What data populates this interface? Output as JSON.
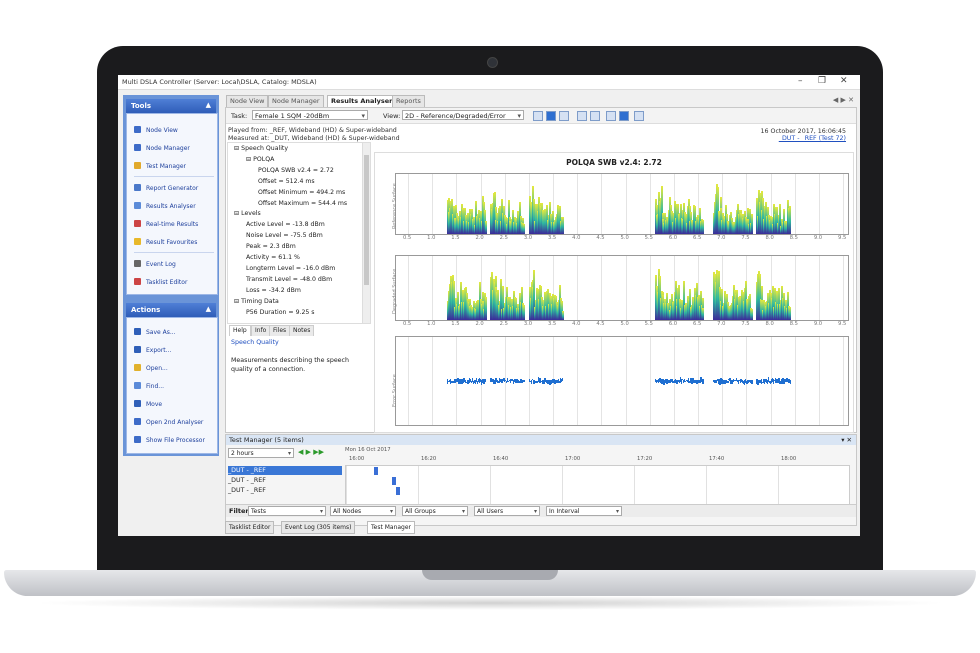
{
  "window": {
    "title": "Multi DSLA Controller (Server: Local\\DSLA, Catalog: MDSLA)",
    "controls": [
      "–",
      "❐",
      "✕"
    ]
  },
  "nav": {
    "tools_header": "Tools",
    "tools": [
      "Node View",
      "Node Manager",
      "Test Manager",
      "Report Generator",
      "Results Analyser",
      "Real-time Results",
      "Result Favourites",
      "Event Log",
      "Tasklist Editor"
    ],
    "actions_header": "Actions",
    "actions": [
      "Save As...",
      "Export...",
      "Open...",
      "Find...",
      "Move",
      "Open 2nd Analyser",
      "Show File Processor"
    ],
    "collapse": "▲"
  },
  "tabs": [
    "Node View",
    "Node Manager",
    "Results Analyser 1",
    "Reports"
  ],
  "tab_close": "✕",
  "nav_arrows": "◀ ▶ ✕",
  "toolbar": {
    "task_label": "Task:",
    "task_value": "Female 1 SQM -20dBm",
    "view_label": "View:",
    "view_value": "2D - Reference/Degraded/Error"
  },
  "info": {
    "played": "Played from: _REF, Wideband (HD) & Super-wideband",
    "measured": "Measured at: _DUT, Wideband (HD) & Super-wideband",
    "date": "16 October 2017, 16:06:45",
    "link": "_DUT - _REF (Test 72)"
  },
  "tree": [
    {
      "indent": 0,
      "text": "⊟ Speech Quality"
    },
    {
      "indent": 1,
      "text": "⊟ POLQA"
    },
    {
      "indent": 2,
      "text": "POLQA SWB v2.4 = 2.72"
    },
    {
      "indent": 2,
      "text": "Offset = 512.4 ms"
    },
    {
      "indent": 2,
      "text": "Offset Minimum = 494.2 ms"
    },
    {
      "indent": 2,
      "text": "Offset Maximum = 544.4 ms"
    },
    {
      "indent": 0,
      "text": "⊟ Levels"
    },
    {
      "indent": 1,
      "text": "Active Level = -13.8 dBm"
    },
    {
      "indent": 1,
      "text": "Noise Level = -75.5 dBm"
    },
    {
      "indent": 1,
      "text": "Peak = 2.3 dBm"
    },
    {
      "indent": 1,
      "text": "Activity = 61.1 %"
    },
    {
      "indent": 1,
      "text": "Longterm Level = -16.0 dBm"
    },
    {
      "indent": 1,
      "text": "Transmit Level = -48.0 dBm"
    },
    {
      "indent": 1,
      "text": "Loss = -34.2 dBm"
    },
    {
      "indent": 0,
      "text": "⊟ Timing Data"
    },
    {
      "indent": 1,
      "text": "P56 Duration = 9.25 s"
    }
  ],
  "help_tabs": [
    "Help",
    "Info",
    "Files",
    "Notes"
  ],
  "help": {
    "title": "Speech Quality",
    "body": "Measurements describing the speech quality of a connection."
  },
  "chart_data": {
    "type": "bar",
    "title": "POLQA SWB v2.4: 2.72",
    "panels": [
      "Reference Surface",
      "Degraded Surface",
      "Error Surface"
    ],
    "x": [
      "0.5",
      "1.0",
      "1.5",
      "2.0",
      "2.5",
      "3.0",
      "3.5",
      "4.0",
      "4.5",
      "5.0",
      "5.5",
      "6.0",
      "6.5",
      "7.0",
      "7.5",
      "8.0",
      "8.5",
      "9.0",
      "9.5"
    ],
    "speech_segments": [
      [
        1.3,
        2.1
      ],
      [
        2.2,
        2.9
      ],
      [
        3.0,
        3.7
      ],
      [
        5.6,
        6.6
      ],
      [
        6.8,
        7.6
      ],
      [
        7.7,
        8.4
      ]
    ],
    "colors": {
      "low": "#3b2a9a",
      "mid": "#2fb8a0",
      "high": "#e7e93c",
      "error": "#1f6fd1"
    }
  },
  "test_manager": {
    "header": "Test Manager (5 items)",
    "pin": "▾ ✕",
    "range": "2 hours",
    "date": "Mon 16 Oct 2017",
    "times": [
      "16:00",
      "16:20",
      "16:40",
      "17:00",
      "17:20",
      "17:40",
      "18:00"
    ],
    "rows": [
      "_DUT - _REF",
      "_DUT - _REF",
      "_DUT - _REF"
    ],
    "filter_label": "Filter:",
    "filters": [
      "Tests",
      "All Nodes",
      "All Groups",
      "All Users",
      "In Interval"
    ]
  },
  "bottom_tabs": [
    "Tasklist Editor",
    "Event Log (305 items)",
    "Test Manager"
  ]
}
